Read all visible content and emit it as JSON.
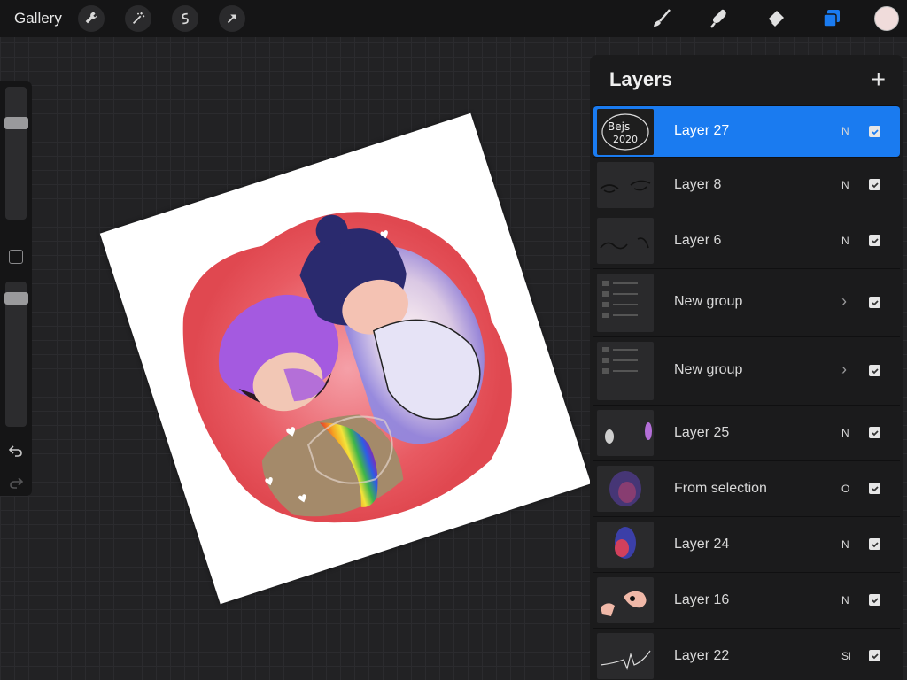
{
  "app": {
    "gallery_label": "Gallery"
  },
  "toolbar": {
    "left_tools": [
      "wrench-icon",
      "magic-wand-icon",
      "selection-icon",
      "transform-arrow-icon"
    ],
    "right_tools": [
      "brush-icon",
      "smudge-icon",
      "eraser-icon",
      "layers-icon"
    ],
    "current_color": "#f0dcdb",
    "accent": "#1a7bf0"
  },
  "sidebar": {
    "undo_icon": "undo-icon",
    "redo_icon": "redo-icon"
  },
  "layers_panel": {
    "title": "Layers",
    "add_label": "+",
    "layers": [
      {
        "name": "Layer 27",
        "mode": "N",
        "visible": true,
        "selected": true,
        "group": false
      },
      {
        "name": "Layer 8",
        "mode": "N",
        "visible": true,
        "selected": false,
        "group": false
      },
      {
        "name": "Layer 6",
        "mode": "N",
        "visible": true,
        "selected": false,
        "group": false
      },
      {
        "name": "New group",
        "mode": "",
        "visible": true,
        "selected": false,
        "group": true
      },
      {
        "name": "New group",
        "mode": "",
        "visible": true,
        "selected": false,
        "group": true
      },
      {
        "name": "Layer 25",
        "mode": "N",
        "visible": true,
        "selected": false,
        "group": false
      },
      {
        "name": "From selection",
        "mode": "O",
        "visible": true,
        "selected": false,
        "group": false
      },
      {
        "name": "Layer 24",
        "mode": "N",
        "visible": true,
        "selected": false,
        "group": false
      },
      {
        "name": "Layer 16",
        "mode": "N",
        "visible": true,
        "selected": false,
        "group": false
      },
      {
        "name": "Layer 22",
        "mode": "Sl",
        "visible": true,
        "selected": false,
        "group": false
      }
    ]
  }
}
